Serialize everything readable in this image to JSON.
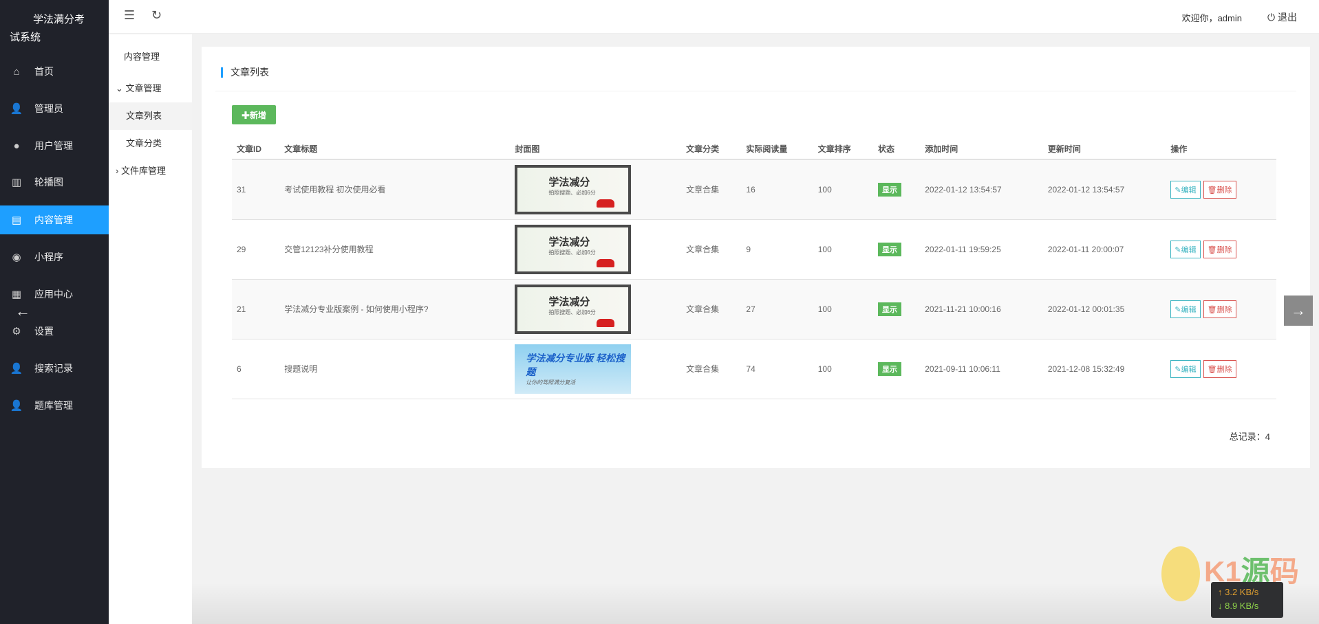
{
  "app": {
    "title_line1": "学法满分考",
    "title_line2": "试系统"
  },
  "sidebar": {
    "items": [
      {
        "label": "首页",
        "icon": "home-icon"
      },
      {
        "label": "管理员",
        "icon": "user-gear-icon"
      },
      {
        "label": "用户管理",
        "icon": "user-icon"
      },
      {
        "label": "轮播图",
        "icon": "books-icon"
      },
      {
        "label": "内容管理",
        "icon": "document-icon",
        "active": true
      },
      {
        "label": "小程序",
        "icon": "miniprogram-icon"
      },
      {
        "label": "应用中心",
        "icon": "apps-icon"
      },
      {
        "label": "设置",
        "icon": "gear-icon"
      },
      {
        "label": "搜索记录",
        "icon": "user-gear-icon"
      },
      {
        "label": "题库管理",
        "icon": "user-gear-icon"
      }
    ]
  },
  "header": {
    "welcome": "欢迎你，admin",
    "logout": "退出"
  },
  "subnav": {
    "title": "内容管理",
    "group1": "文章管理",
    "child1": "文章列表",
    "child2": "文章分类",
    "group2": "文件库管理"
  },
  "main": {
    "title": "文章列表",
    "add_label": "新增",
    "columns": [
      "文章ID",
      "文章标题",
      "封面图",
      "文章分类",
      "实际阅读量",
      "文章排序",
      "状态",
      "添加时间",
      "更新时间",
      "操作"
    ],
    "rows": [
      {
        "id": "31",
        "title": "考试使用教程 初次使用必看",
        "cover": "学法减分",
        "cover_sub": "拍照搜题、必加6分",
        "category": "文章合集",
        "reads": "16",
        "sort": "100",
        "status": "显示",
        "added": "2022-01-12 13:54:57",
        "updated": "2022-01-12 13:54:57"
      },
      {
        "id": "29",
        "title": "交管12123补分使用教程",
        "cover": "学法减分",
        "cover_sub": "拍照搜题、必加6分",
        "category": "文章合集",
        "reads": "9",
        "sort": "100",
        "status": "显示",
        "added": "2022-01-11 19:59:25",
        "updated": "2022-01-11 20:00:07"
      },
      {
        "id": "21",
        "title": "学法减分专业版案例 - 如何使用小程序?",
        "cover": "学法减分",
        "cover_sub": "拍照搜题、必加6分",
        "category": "文章合集",
        "reads": "27",
        "sort": "100",
        "status": "显示",
        "added": "2021-11-21 10:00:16",
        "updated": "2022-01-12 00:01:35"
      },
      {
        "id": "6",
        "title": "搜题说明",
        "cover": "学法减分专业版 轻松搜题",
        "cover_sub": "让你的驾照满分复活",
        "category": "文章合集",
        "reads": "74",
        "sort": "100",
        "status": "显示",
        "added": "2021-09-11 10:06:11",
        "updated": "2021-12-08 15:32:49"
      }
    ],
    "edit_label": "编辑",
    "delete_label": "删除",
    "total": "总记录：4"
  },
  "overlay": {
    "watermark": "K1源码",
    "upload_speed": "↑ 3.2 KB/s",
    "download_speed": "↓ 8.9 KB/s"
  }
}
